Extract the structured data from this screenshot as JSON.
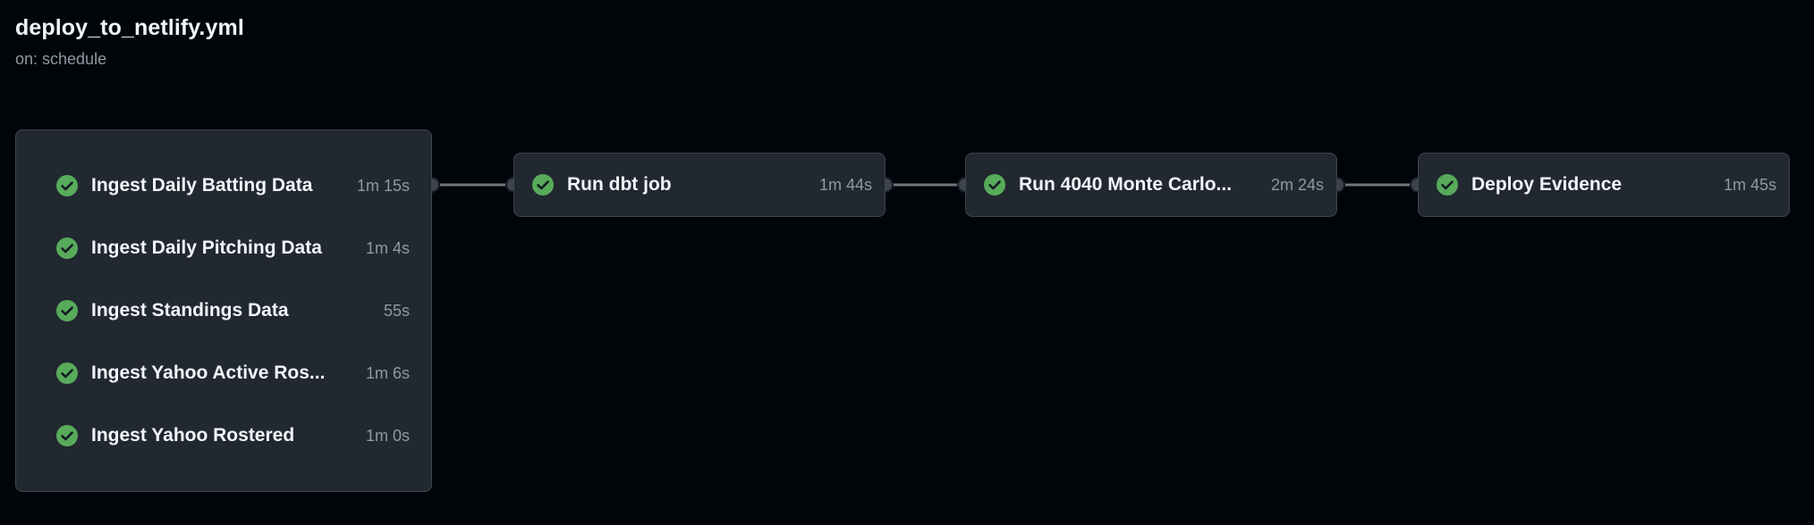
{
  "workflow": {
    "title": "deploy_to_netlify.yml",
    "trigger": "on: schedule"
  },
  "status_color": "#57ab5a",
  "icons": {
    "job_status": "check-circle-icon",
    "connector": "connector-dot-icon"
  },
  "group": {
    "jobs": [
      {
        "name": "Ingest Daily Batting Data",
        "duration": "1m 15s",
        "status": "success"
      },
      {
        "name": "Ingest Daily Pitching Data",
        "duration": "1m 4s",
        "status": "success"
      },
      {
        "name": "Ingest Standings Data",
        "duration": "55s",
        "status": "success"
      },
      {
        "name": "Ingest Yahoo Active Ros...",
        "duration": "1m 6s",
        "status": "success"
      },
      {
        "name": "Ingest Yahoo Rostered",
        "duration": "1m 0s",
        "status": "success"
      }
    ]
  },
  "stages": [
    {
      "name": "Run dbt job",
      "duration": "1m 44s",
      "status": "success"
    },
    {
      "name": "Run 4040 Monte Carlo...",
      "duration": "2m 24s",
      "status": "success"
    },
    {
      "name": "Deploy Evidence",
      "duration": "1m 45s",
      "status": "success"
    }
  ]
}
